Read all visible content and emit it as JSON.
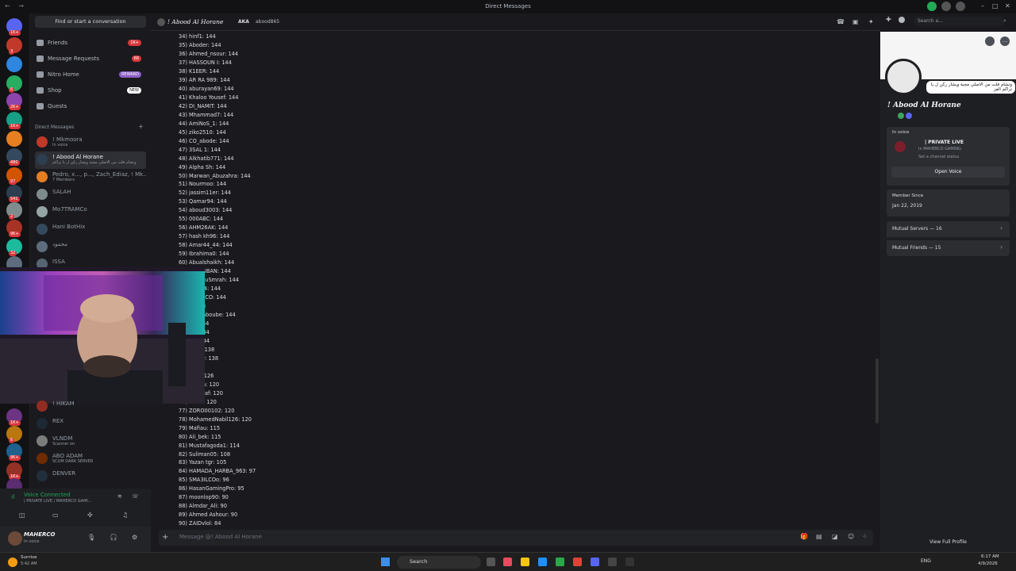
{
  "window": {
    "title": "Direct Messages",
    "search_placeholder": "Search a..."
  },
  "server_badges": [
    "1K+",
    "3",
    "",
    "6",
    "2K+",
    "1K+",
    "",
    "480",
    "97",
    "541",
    "2",
    "9K+",
    "32",
    "",
    "17",
    "1K+",
    "6",
    "9K+",
    "1K+",
    "NEW"
  ],
  "dm_panel": {
    "find_placeholder": "Find or start a conversation",
    "nav": [
      {
        "label": "Friends",
        "pill": "1K+",
        "pill_color": "#da373c"
      },
      {
        "label": "Message Requests",
        "pill": "68",
        "pill_color": "#da373c"
      },
      {
        "label": "Nitro Home",
        "pill": "REWARD",
        "pill_color": "#8c5fc6"
      },
      {
        "label": "Shop",
        "pill": "NEW",
        "pill_color": "#ffffff"
      },
      {
        "label": "Quests",
        "pill": "",
        "pill_color": ""
      }
    ],
    "section_header": "Direct Messages",
    "dms": [
      {
        "name": "! Mkmoora",
        "sub": "In voice",
        "color": "#c0392b"
      },
      {
        "name": "! Abood Al Horane",
        "sub": "وتشام قلت من الاصلي مجبة ويشار ركن ل يا تراكم",
        "color": "#2c3e50"
      },
      {
        "name": "Pedro, x..., p..., Zach_Ediaz, ! Mk...",
        "sub": "7 Members",
        "color": "#e67e22"
      },
      {
        "name": "SALAH",
        "sub": "",
        "color": "#7f8c8d"
      },
      {
        "name": "Mo7TRAMCo",
        "sub": "",
        "color": "#95a5a6"
      },
      {
        "name": "Hani BotHix",
        "sub": "",
        "color": "#34495e"
      },
      {
        "name": "محمود",
        "sub": "",
        "color": "#5d6d7e"
      },
      {
        "name": "ISSA",
        "sub": "",
        "color": "#566573"
      }
    ],
    "dms_lower": [
      {
        "name": "! HIKAM",
        "sub": "",
        "color": "#922b21"
      },
      {
        "name": "REX",
        "sub": "",
        "color": "#1c2833"
      },
      {
        "name": "VLNDM",
        "sub": "Scanner on",
        "color": "#7b7d7d"
      },
      {
        "name": "ABO ADAM",
        "sub": "SCUM DARK SERVER",
        "color": "#6e2c00"
      },
      {
        "name": "DENVER",
        "sub": "",
        "color": "#212f3c"
      }
    ],
    "voice": {
      "status": "Voice Connected",
      "channel": "| PRIVATE LIVE / MAHERCO GAMI..."
    },
    "user": {
      "name": "MAHERCO",
      "status": "In voice"
    }
  },
  "chat": {
    "header_name": "! Abood Al Horane",
    "header_aka": "AKA",
    "header_aka_value": "abood865",
    "composer_placeholder": "Message @! Abood Al Horane",
    "lines": [
      "34) hinf1: 144",
      "35) Aboder: 144",
      "36) Ahmed_nsour: 144",
      "37) HASSOUN  I: 144",
      "38) K1EER: 144",
      "39) AR  RA  989: 144",
      "40) aburayan69: 144",
      "41) Khaloo  Yousef: 144",
      "42) DI_NAMIT: 144",
      "43) Mhammad7: 144",
      "44) AmiNoS_1: 144",
      "45) ziko2510: 144",
      "46) CO_abode: 144",
      "47) 3SAL  1: 144",
      "48) Alkhatib771: 144",
      "49) Alpha  Sh: 144",
      "50) Marwan_Abuzahra: 144",
      "51) Nourmoo: 144",
      "52) jassim11er: 144",
      "53) Qamar94: 144",
      "54) aboud3003: 144",
      "55) 000ABC: 144",
      "56) AHM26AK: 144",
      "57) hash  kh96: 144",
      "58) Amar44_44: 144",
      "59) Ibrahima0: 144",
      "60) Abualshaikh: 144",
      "61) ADALSBAN: 144",
      "62) ad_AbuSmrah: 144",
      "63) 024  24: 144",
      "64) 3RBiDCO: 144",
      "65) A: 144",
      "66) _el_Baboube: 144",
      "67) 95: 144",
      "68) AK: 144",
      "69) AA: 144",
      "70) ilsy2: 138",
      "71) aldyry: 138",
      "72) r: 130",
      "73) y  22: 126",
      "74) ussien: 120",
      "75) abuseaf: 120",
      "76) Shalil: 120",
      "77) ZORO00102: 120",
      "78) MohamedNabil126: 120",
      "79) Mafiau: 115",
      "80) Ali_bek: 115",
      "81) Mustafagoda1: 114",
      "82) Suliman05: 108",
      "83) Yazan  tgr: 105",
      "84) HAMADA_HARBA_963: 97",
      "85) SMA3ILCOo: 96",
      "86) HasanGamingPro: 95",
      "87) moonlop90: 90",
      "88) Almdar_Ali: 90",
      "89) Ahmed  Ashour: 90",
      "90) ZAIDvlol: 84"
    ]
  },
  "profile": {
    "name": "! Abood Al Horane",
    "bio": "وتشام قلت من الاصلي مجبة ويشار ركن ل يا تراكم الفز",
    "section_voice": "In voice",
    "voice_channel": "| PRIVATE LIVE",
    "voice_server": "In MAHERCO GAMING",
    "voice_status_hint": "Set a channel status",
    "open_voice": "Open Voice",
    "member_since_label": "Member Since",
    "member_since": "Jan 22, 2019",
    "mutual_servers": "Mutual Servers — 16",
    "mutual_friends": "Mutual Friends — 15",
    "view_full": "View Full Profile"
  },
  "taskbar": {
    "weather_temp": "Sunrise",
    "weather_time": "5:42 AM",
    "search": "Search",
    "lang": "ENG",
    "time": "6:17 AM",
    "date": "4/9/2026"
  }
}
